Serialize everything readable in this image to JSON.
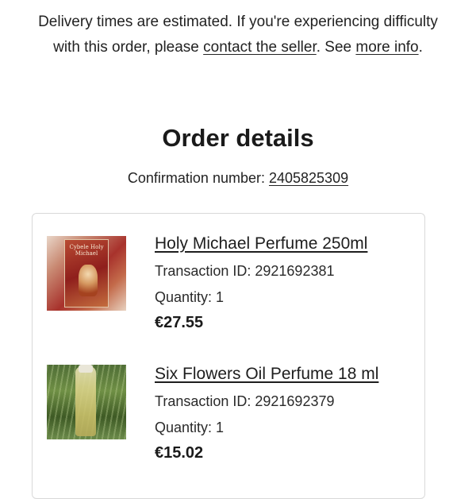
{
  "notice": {
    "text_before": "Delivery times are estimated. If you're experiencing difficulty with this order, please ",
    "contact_link": "contact the seller",
    "text_middle": ". See ",
    "more_link": "more info",
    "text_after": "."
  },
  "order": {
    "title": "Order details",
    "confirmation_label": "Confirmation number: ",
    "confirmation_number": "2405825309"
  },
  "items": [
    {
      "name": "Holy Michael Perfume 250ml",
      "transaction": "Transaction ID: 2921692381",
      "quantity": "Quantity: 1",
      "price": "€27.55",
      "image_label": "Cybele Holy Michael"
    },
    {
      "name": "Six Flowers Oil Perfume 18 ml",
      "transaction": "Transaction ID: 2921692379",
      "quantity": "Quantity: 1",
      "price": "€15.02"
    }
  ]
}
